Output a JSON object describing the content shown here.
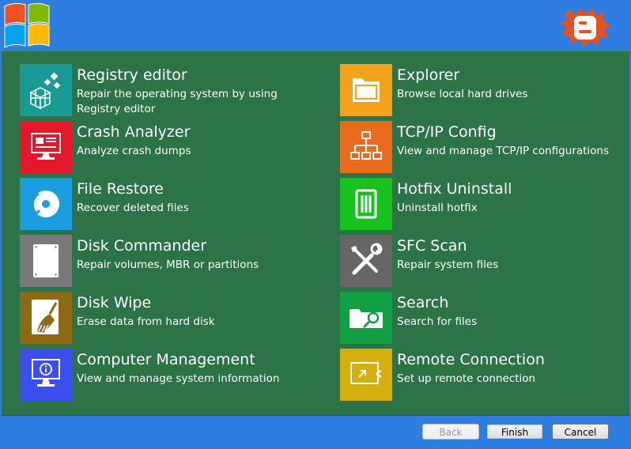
{
  "colors": {
    "header_bg": "#2e7de0",
    "panel_bg": "#2c7347"
  },
  "tools": [
    {
      "title": "Registry editor",
      "desc": "Repair the operating system by using Registry editor",
      "icon": "registry-icon",
      "color": "#1a9a95"
    },
    {
      "title": "Crash Analyzer",
      "desc": "Analyze crash dumps",
      "icon": "crash-monitor-icon",
      "color": "#e3182a"
    },
    {
      "title": "File Restore",
      "desc": "Recover deleted files",
      "icon": "disc-restore-icon",
      "color": "#1a9ee0"
    },
    {
      "title": "Disk Commander",
      "desc": "Repair volumes, MBR or partitions",
      "icon": "hard-disk-icon",
      "color": "#7a7a7a"
    },
    {
      "title": "Disk Wipe",
      "desc": "Erase data from hard disk",
      "icon": "broom-disk-icon",
      "color": "#8f6a14"
    },
    {
      "title": "Computer Management",
      "desc": "View and manage system information",
      "icon": "computer-info-icon",
      "color": "#3d4ef0"
    },
    {
      "title": "Explorer",
      "desc": "Browse local hard drives",
      "icon": "folder-icon",
      "color": "#f2a21a"
    },
    {
      "title": "TCP/IP Config",
      "desc": "View and manage TCP/IP configurations",
      "icon": "network-icon",
      "color": "#ea6a1e"
    },
    {
      "title": "Hotfix Uninstall",
      "desc": "Uninstall hotfix",
      "icon": "trash-can-icon",
      "color": "#18c21e"
    },
    {
      "title": "SFC Scan",
      "desc": "Repair system files",
      "icon": "tools-icon",
      "color": "#666666"
    },
    {
      "title": "Search",
      "desc": "Search for files",
      "icon": "search-folder-icon",
      "color": "#12a045"
    },
    {
      "title": "Remote Connection",
      "desc": "Set up remote connection",
      "icon": "remote-screen-icon",
      "color": "#d4b00c"
    }
  ],
  "buttons": {
    "back": "Back",
    "finish": "Finish",
    "cancel": "Cancel"
  }
}
